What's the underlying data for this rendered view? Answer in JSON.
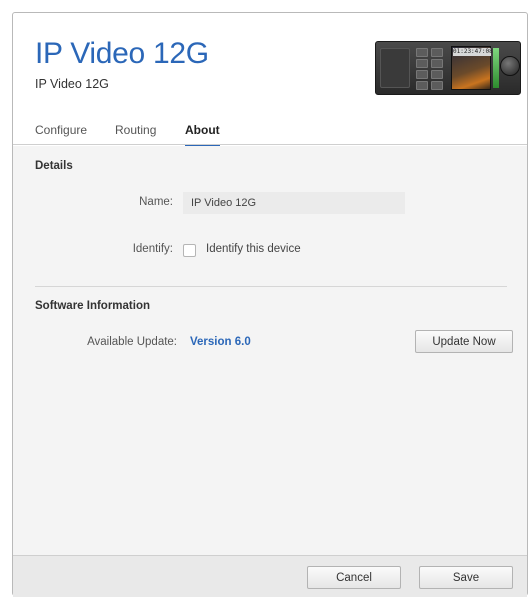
{
  "header": {
    "title": "IP Video 12G",
    "subtitle": "IP Video 12G",
    "device_timecode": "01:23:47:08"
  },
  "tabs": [
    {
      "label": "Configure",
      "active": false
    },
    {
      "label": "Routing",
      "active": false
    },
    {
      "label": "About",
      "active": true
    }
  ],
  "details": {
    "section_title": "Details",
    "name_label": "Name:",
    "name_value": "IP Video 12G",
    "identify_label": "Identify:",
    "identify_checkbox_label": "Identify this device",
    "identify_checked": false
  },
  "software": {
    "section_title": "Software Information",
    "update_label": "Available Update:",
    "update_version": "Version 6.0",
    "update_button": "Update Now"
  },
  "footer": {
    "cancel_label": "Cancel",
    "save_label": "Save"
  },
  "colors": {
    "accent": "#2b67b8",
    "content_bg": "#f4f4f4",
    "footer_bg": "#e9e9e9"
  }
}
